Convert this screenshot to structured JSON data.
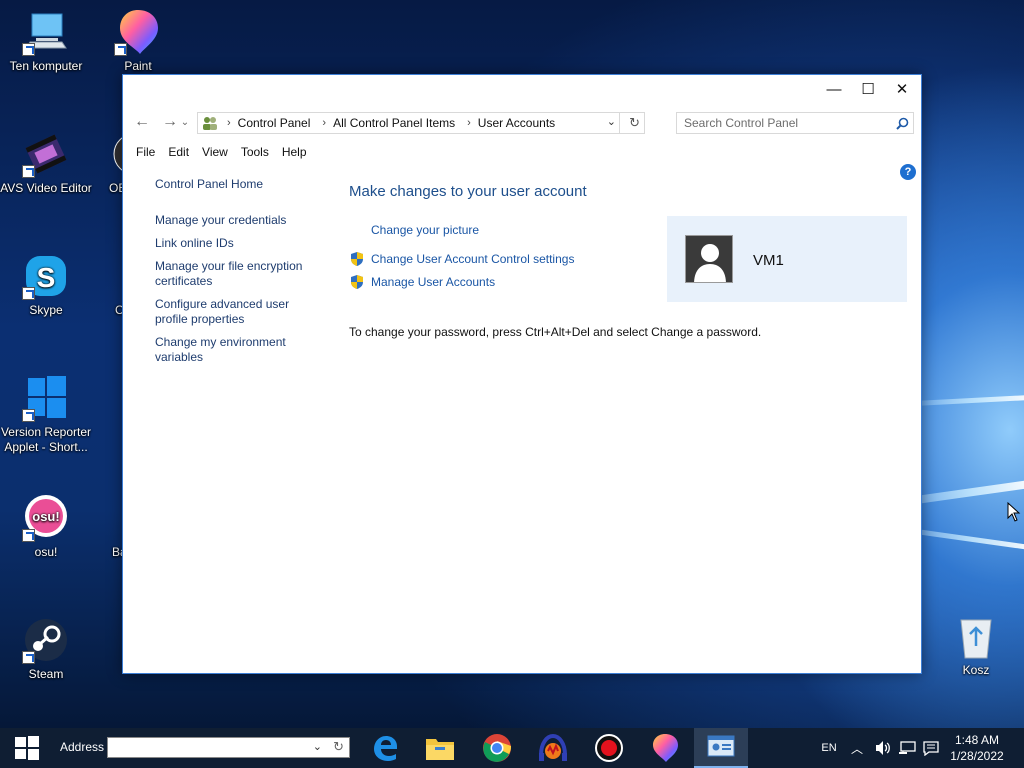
{
  "desktop": {
    "icons": [
      {
        "label": "Ten komputer",
        "icon": "computer-icon"
      },
      {
        "label": "Paint",
        "icon": "paint-icon"
      },
      {
        "label": "AVS Video Editor",
        "icon": "film-icon"
      },
      {
        "label": "OB",
        "icon": "obs-icon"
      },
      {
        "label": "Skype",
        "icon": "skype-icon"
      },
      {
        "label": "C",
        "icon": "app-icon"
      },
      {
        "label": "Version Reporter Applet - Short...",
        "icon": "windows-logo-icon"
      },
      {
        "label": "osu!",
        "icon": "osu-icon"
      },
      {
        "label": "Ba",
        "icon": "app-icon"
      },
      {
        "label": "Steam",
        "icon": "steam-icon"
      },
      {
        "label": "Kosz",
        "icon": "recycle-bin-icon"
      }
    ]
  },
  "window": {
    "controls": {
      "minimize": "—",
      "maximize": "☐",
      "close": "✕"
    },
    "breadcrumb": [
      "Control Panel",
      "All Control Panel Items",
      "User Accounts"
    ],
    "search_placeholder": "Search Control Panel",
    "menu": [
      "File",
      "Edit",
      "View",
      "Tools",
      "Help"
    ],
    "left_pane": {
      "home": "Control Panel Home",
      "links": [
        "Manage your credentials",
        "Link online IDs",
        "Manage your file encryption certificates",
        "Configure advanced user profile properties",
        "Change my environment variables"
      ]
    },
    "content": {
      "heading": "Make changes to your user account",
      "tasks": [
        {
          "label": "Change your picture",
          "shield": false
        },
        {
          "label": "Change User Account Control settings",
          "shield": true
        },
        {
          "label": "Manage User Accounts",
          "shield": true
        }
      ],
      "user_name": "VM1",
      "password_note": "To change your password, press Ctrl+Alt+Del and select Change a password."
    },
    "help_label": "?"
  },
  "taskbar": {
    "address_label": "Address",
    "address_value": "",
    "apps": [
      "edge-icon",
      "file-explorer-icon",
      "chrome-icon",
      "audio-app-icon",
      "record-icon",
      "paint-icon",
      "control-panel-icon"
    ],
    "language": "EN",
    "time": "1:48 AM",
    "date": "1/28/2022"
  }
}
